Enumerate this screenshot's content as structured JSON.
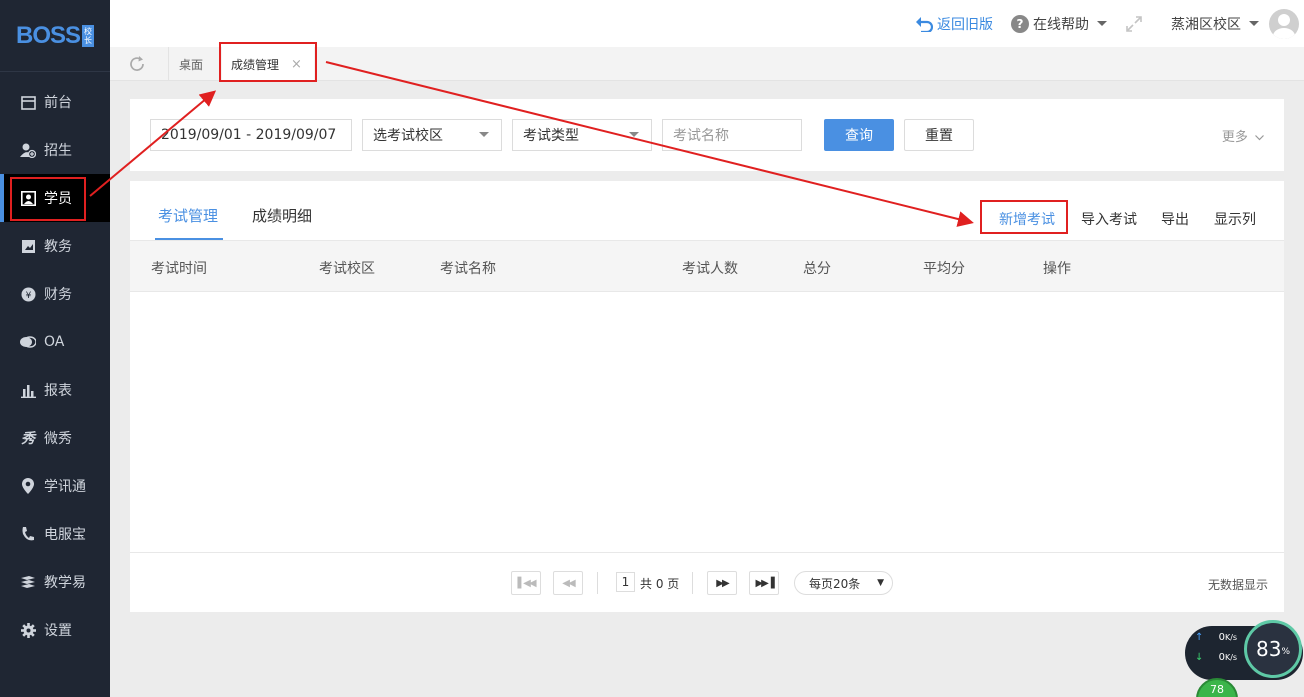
{
  "app": {
    "logo_text": "BOSS",
    "logo_badge": "校长"
  },
  "topbar": {
    "back_old": "返回旧版",
    "help": "在线帮助",
    "campus": "蒸湘区校区"
  },
  "sidebar": {
    "items": [
      {
        "label": "前台",
        "icon": "calendar-icon"
      },
      {
        "label": "招生",
        "icon": "add-user-icon"
      },
      {
        "label": "学员",
        "icon": "student-card-icon",
        "active": true
      },
      {
        "label": "教务",
        "icon": "book-icon"
      },
      {
        "label": "财务",
        "icon": "yen-icon"
      },
      {
        "label": "OA",
        "icon": "chat-icon"
      },
      {
        "label": "报表",
        "icon": "bar-chart-icon"
      },
      {
        "label": "微秀",
        "icon": "xiu-icon"
      },
      {
        "label": "学讯通",
        "icon": "location-pin-icon"
      },
      {
        "label": "电服宝",
        "icon": "phone-icon"
      },
      {
        "label": "教学易",
        "icon": "teaching-icon"
      },
      {
        "label": "设置",
        "icon": "gear-icon"
      }
    ]
  },
  "tabs": {
    "desk": "桌面",
    "score": "成绩管理",
    "close": "×"
  },
  "filter": {
    "date_range": "2019/09/01 - 2019/09/07",
    "campus_select": "选考试校区",
    "type_select": "考试类型",
    "name_placeholder": "考试名称",
    "query_button": "查询",
    "reset_button": "重置",
    "more": "更多"
  },
  "main": {
    "tabs": [
      "考试管理",
      "成绩明细"
    ],
    "actions": [
      "新增考试",
      "导入考试",
      "导出",
      "显示列"
    ],
    "columns": [
      "考试时间",
      "考试校区",
      "考试名称",
      "考试人数",
      "总分",
      "平均分",
      "操作"
    ],
    "rows": []
  },
  "pager": {
    "page": "1",
    "total": "共 0 页",
    "page_size": "每页20条",
    "no_data": "无数据显示"
  },
  "net_widget": {
    "up": "0",
    "down": "0",
    "unit": "K/s",
    "percent": "83",
    "percent_unit": "%",
    "score": "78"
  }
}
